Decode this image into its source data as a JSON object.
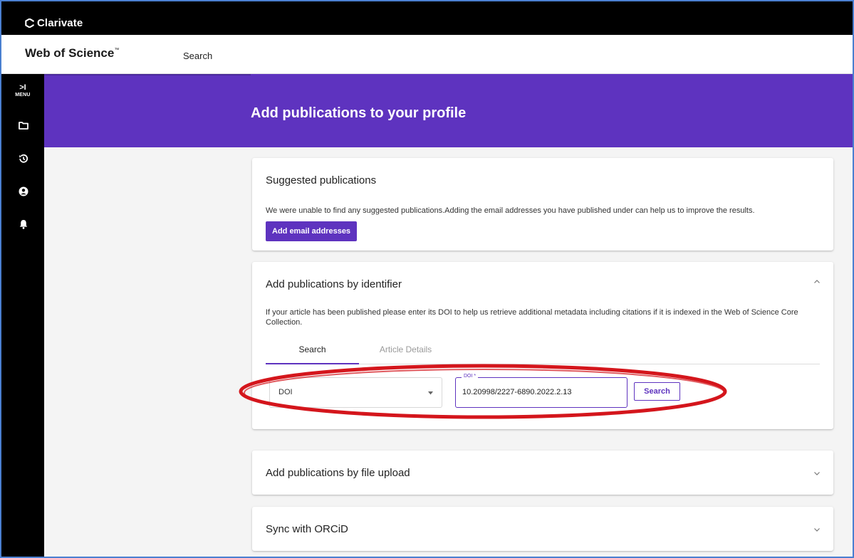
{
  "brand": {
    "name": "Clarivate"
  },
  "header": {
    "product": "Web of Science",
    "trademark": "™",
    "nav_search": "Search"
  },
  "rail": {
    "toggle_glyph": ">I",
    "menu_label": "MENU"
  },
  "banner": {
    "title": "Add publications to your profile"
  },
  "suggested": {
    "title": "Suggested publications",
    "text": "We were unable to find any suggested publications.Adding the email addresses you have published under can help us to improve the results.",
    "button": "Add email addresses"
  },
  "identifier": {
    "title": "Add publications by identifier",
    "text": "If your article has been published please enter its DOI to help us retrieve additional metadata including citations if it is indexed in the Web of Science Core Collection.",
    "tabs": [
      {
        "label": "Search"
      },
      {
        "label": "Article Details"
      }
    ],
    "select_value": "DOI",
    "doi_label": "DOI *",
    "doi_value": "10.20998/2227-6890.2022.2.13",
    "search_button": "Search"
  },
  "file_upload": {
    "title": "Add publications by file upload"
  },
  "orcid": {
    "title": "Sync with ORCiD"
  },
  "colors": {
    "brand_purple": "#5e33bf",
    "annotation_red": "#d4161c",
    "rail_black": "#000000"
  }
}
